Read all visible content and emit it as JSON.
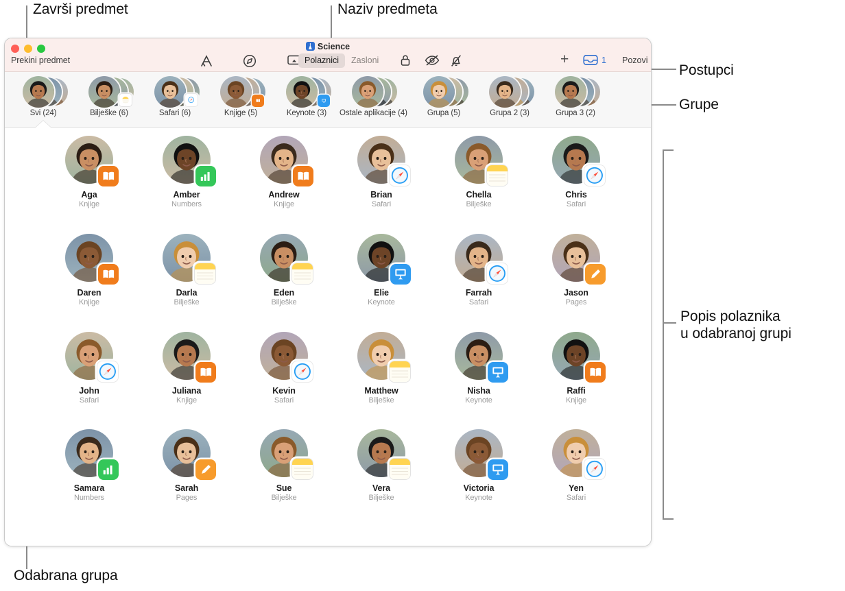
{
  "callouts": [
    {
      "id": "end-class",
      "text": "Završi predmet"
    },
    {
      "id": "class-name",
      "text": "Naziv predmeta"
    },
    {
      "id": "actions",
      "text": "Postupci"
    },
    {
      "id": "groups",
      "text": "Grupe"
    },
    {
      "id": "student-list",
      "text": "Popis polaznika\nu odabranoj grupi"
    },
    {
      "id": "selected-group",
      "text": "Odabrana grupa"
    }
  ],
  "window": {
    "end_class_button": "Prekini predmet",
    "title": "Science",
    "toolbar": {
      "icons": [
        "appstore-icon",
        "safari-compass-icon",
        "airplay-screen-icon",
        "lock-icon",
        "hide-eye-icon",
        "mute-bell-icon"
      ],
      "segmented": {
        "selected": "Polaznici",
        "options": [
          "Polaznici",
          "Zasloni"
        ]
      },
      "add_label": "+",
      "inbox_count": "1",
      "invite_label": "Pozovi"
    }
  },
  "groups": [
    {
      "label": "Svi (24)",
      "badge": "none",
      "selected": true
    },
    {
      "label": "Bilješke (6)",
      "badge": "notes",
      "selected": false
    },
    {
      "label": "Safari (6)",
      "badge": "safari",
      "selected": false
    },
    {
      "label": "Knjige (5)",
      "badge": "books",
      "selected": false
    },
    {
      "label": "Keynote (3)",
      "badge": "keynote",
      "selected": false
    },
    {
      "label": "Ostale aplikacije (4)",
      "badge": "none",
      "selected": false
    },
    {
      "label": "Grupa (5)",
      "badge": "none",
      "selected": false
    },
    {
      "label": "Grupa 2 (3)",
      "badge": "none",
      "selected": false
    },
    {
      "label": "Grupa 3 (2)",
      "badge": "none",
      "selected": false
    }
  ],
  "students": [
    {
      "name": "Aga",
      "app": "Knjige",
      "badge": "books"
    },
    {
      "name": "Amber",
      "app": "Numbers",
      "badge": "numbers"
    },
    {
      "name": "Andrew",
      "app": "Knjige",
      "badge": "books"
    },
    {
      "name": "Brian",
      "app": "Safari",
      "badge": "safari"
    },
    {
      "name": "Chella",
      "app": "Bilješke",
      "badge": "notes"
    },
    {
      "name": "Chris",
      "app": "Safari",
      "badge": "safari"
    },
    {
      "name": "Daren",
      "app": "Knjige",
      "badge": "books"
    },
    {
      "name": "Darla",
      "app": "Bilješke",
      "badge": "notes"
    },
    {
      "name": "Eden",
      "app": "Bilješke",
      "badge": "notes"
    },
    {
      "name": "Elie",
      "app": "Keynote",
      "badge": "keynote"
    },
    {
      "name": "Farrah",
      "app": "Safari",
      "badge": "safari"
    },
    {
      "name": "Jason",
      "app": "Pages",
      "badge": "pages"
    },
    {
      "name": "John",
      "app": "Safari",
      "badge": "safari"
    },
    {
      "name": "Juliana",
      "app": "Knjige",
      "badge": "books"
    },
    {
      "name": "Kevin",
      "app": "Safari",
      "badge": "safari"
    },
    {
      "name": "Matthew",
      "app": "Bilješke",
      "badge": "notes"
    },
    {
      "name": "Nisha",
      "app": "Keynote",
      "badge": "keynote"
    },
    {
      "name": "Raffi",
      "app": "Knjige",
      "badge": "books"
    },
    {
      "name": "Samara",
      "app": "Numbers",
      "badge": "numbers"
    },
    {
      "name": "Sarah",
      "app": "Pages",
      "badge": "pages"
    },
    {
      "name": "Sue",
      "app": "Bilješke",
      "badge": "notes"
    },
    {
      "name": "Vera",
      "app": "Bilješke",
      "badge": "notes"
    },
    {
      "name": "Victoria",
      "app": "Keynote",
      "badge": "keynote"
    },
    {
      "name": "Yen",
      "app": "Safari",
      "badge": "safari"
    }
  ],
  "colors": {
    "titlebar_bg": "#fbeeec",
    "accent_blue": "#2f6fd0",
    "books_orange": "#f07c1c",
    "numbers_green": "#34c759",
    "pages_orange": "#f79b2c",
    "keynote_blue": "#2f9bf0",
    "notes_yellow": "#ffd452"
  }
}
